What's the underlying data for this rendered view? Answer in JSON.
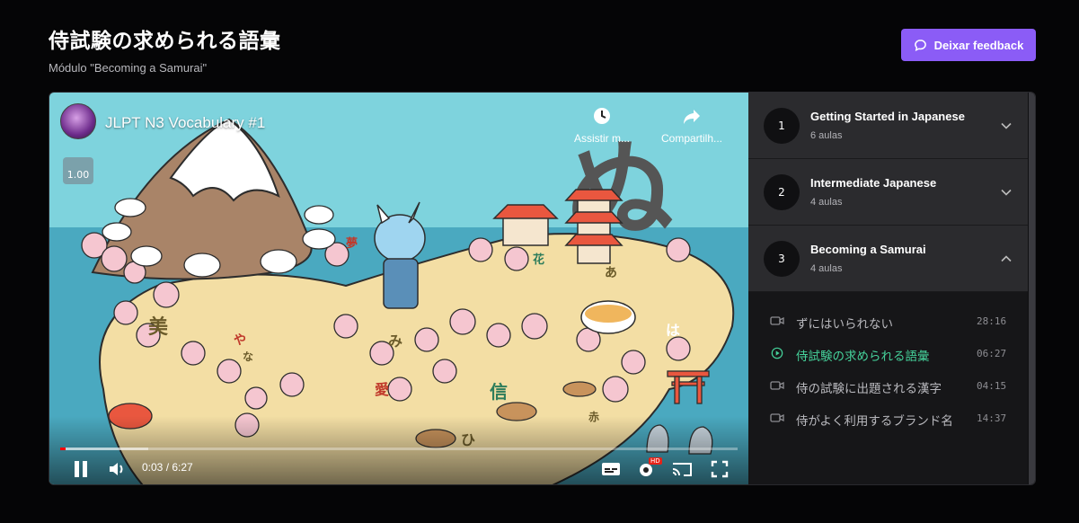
{
  "header": {
    "title": "侍試験の求められる語彙",
    "subtitle": "Módulo \"Becoming a Samurai\"",
    "feedback_label": "Deixar feedback"
  },
  "player": {
    "video_title": "JLPT N3 Vocabulary #1",
    "speed_badge": "1.00",
    "watch_later_label": "Assistir m...",
    "share_label": "Compartilh...",
    "time_display": "0:03 / 6:27",
    "played_fraction": 0.008,
    "loaded_fraction": 0.13,
    "quality_badge": "HD",
    "scene_kana": [
      "ぬ",
      "美",
      "や",
      "み",
      "な",
      "あ",
      "は",
      "信",
      "花",
      "ひ",
      "夢",
      "愛",
      "赤"
    ]
  },
  "sidebar": {
    "modules": [
      {
        "number": "1",
        "title": "Getting Started in Japanese",
        "count": "6 aulas",
        "expanded": false
      },
      {
        "number": "2",
        "title": "Intermediate Japanese",
        "count": "4 aulas",
        "expanded": false
      },
      {
        "number": "3",
        "title": "Becoming a Samurai",
        "count": "4 aulas",
        "expanded": true
      }
    ],
    "lessons": [
      {
        "title": "ずにはいられない",
        "duration": "28:16",
        "active": false
      },
      {
        "title": "侍試験の求められる語彙",
        "duration": "06:27",
        "active": true
      },
      {
        "title": "侍の試験に出題される漢字",
        "duration": "04:15",
        "active": false
      },
      {
        "title": "侍がよく利用するブランド名",
        "duration": "14:37",
        "active": false
      }
    ]
  },
  "colors": {
    "accent": "#8b5cf6",
    "active_lesson": "#45d19a",
    "progress": "#ff0000"
  }
}
